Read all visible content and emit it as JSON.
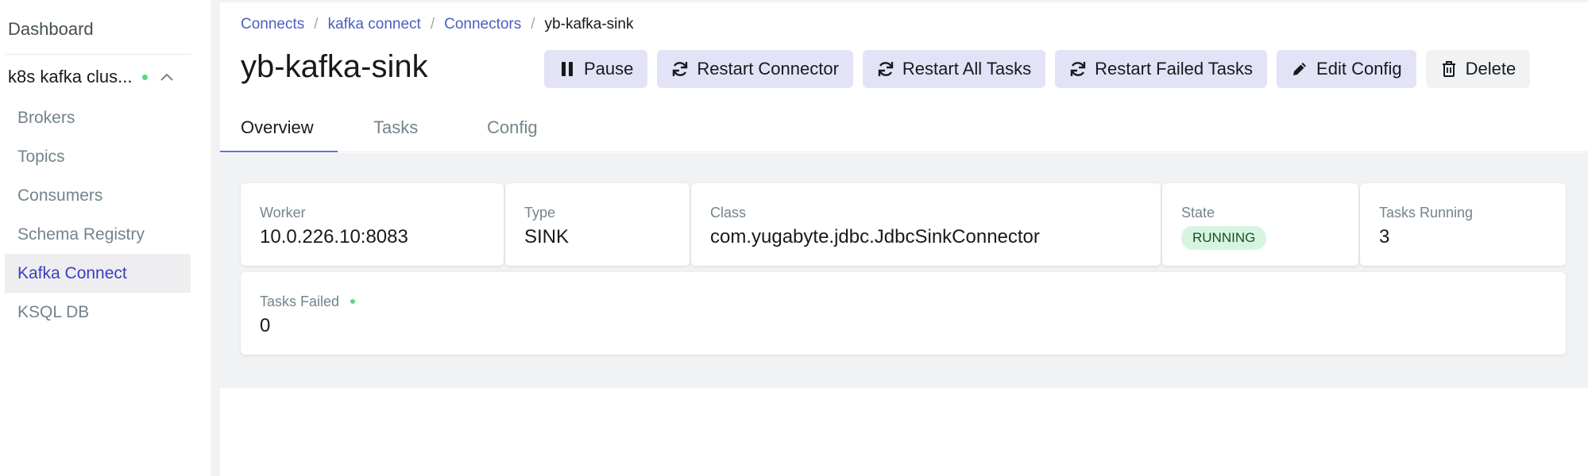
{
  "sidebar": {
    "dashboard": "Dashboard",
    "cluster_name": "k8s kafka clus...",
    "items": [
      {
        "label": "Brokers",
        "active": false
      },
      {
        "label": "Topics",
        "active": false
      },
      {
        "label": "Consumers",
        "active": false
      },
      {
        "label": "Schema Registry",
        "active": false
      },
      {
        "label": "Kafka Connect",
        "active": true
      },
      {
        "label": "KSQL DB",
        "active": false
      }
    ]
  },
  "breadcrumb": {
    "items": [
      "Connects",
      "kafka connect",
      "Connectors"
    ],
    "current": "yb-kafka-sink"
  },
  "page": {
    "title": "yb-kafka-sink"
  },
  "toolbar": {
    "pause": "Pause",
    "restart_connector": "Restart Connector",
    "restart_all_tasks": "Restart All Tasks",
    "restart_failed_tasks": "Restart Failed Tasks",
    "edit_config": "Edit Config",
    "delete": "Delete"
  },
  "tabs": [
    "Overview",
    "Tasks",
    "Config"
  ],
  "overview": {
    "worker_label": "Worker",
    "worker_value": "10.0.226.10:8083",
    "type_label": "Type",
    "type_value": "SINK",
    "class_label": "Class",
    "class_value": "com.yugabyte.jdbc.JdbcSinkConnector",
    "state_label": "State",
    "state_value": "RUNNING",
    "tasks_running_label": "Tasks Running",
    "tasks_running_value": "3",
    "tasks_failed_label": "Tasks Failed",
    "tasks_failed_value": "0"
  },
  "icons": {
    "status_dot": "green-dot-icon",
    "collapse": "chevron-up-icon",
    "pause": "pause-icon",
    "restart": "refresh-icon",
    "edit": "pencil-icon",
    "delete": "trash-icon"
  },
  "colors": {
    "accent": "#4c4cff",
    "button_bg": "#e3e3f7",
    "status_green": "#5cd685",
    "running_badge_bg": "#d6f5e0"
  }
}
